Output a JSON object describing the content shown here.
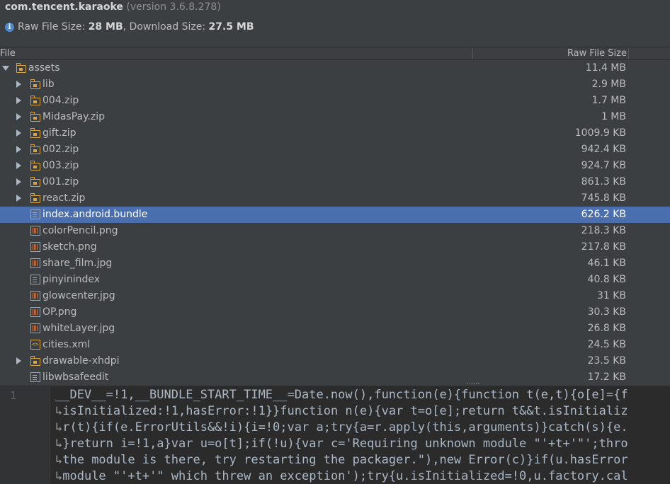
{
  "header": {
    "package_name": "com.tencent.karaoke",
    "version_text": " (version 3.6.8.278)",
    "raw_size_label": "Raw File Size: ",
    "raw_size_value": "28 MB",
    "download_size_label": ", Download Size: ",
    "download_size_value": "27.5 MB"
  },
  "columns": {
    "file": "File",
    "raw_size": "Raw File Size"
  },
  "tree": [
    {
      "name": "assets",
      "size": "11.4 MB",
      "type": "folder",
      "expanded": true,
      "depth": 0,
      "selected": false
    },
    {
      "name": "lib",
      "size": "2.9 MB",
      "type": "folder",
      "expanded": false,
      "depth": 1,
      "selected": false
    },
    {
      "name": "004.zip",
      "size": "1.7 MB",
      "type": "folder",
      "expanded": false,
      "depth": 1,
      "selected": false
    },
    {
      "name": "MidasPay.zip",
      "size": "1 MB",
      "type": "folder",
      "expanded": false,
      "depth": 1,
      "selected": false
    },
    {
      "name": "gift.zip",
      "size": "1009.9 KB",
      "type": "folder",
      "expanded": false,
      "depth": 1,
      "selected": false
    },
    {
      "name": "002.zip",
      "size": "942.4 KB",
      "type": "folder",
      "expanded": false,
      "depth": 1,
      "selected": false
    },
    {
      "name": "003.zip",
      "size": "924.7 KB",
      "type": "folder",
      "expanded": false,
      "depth": 1,
      "selected": false
    },
    {
      "name": "001.zip",
      "size": "861.3 KB",
      "type": "folder",
      "expanded": false,
      "depth": 1,
      "selected": false
    },
    {
      "name": "react.zip",
      "size": "745.8 KB",
      "type": "folder",
      "expanded": false,
      "depth": 1,
      "selected": false
    },
    {
      "name": "index.android.bundle",
      "size": "626.2 KB",
      "type": "file",
      "depth": 1,
      "selected": true
    },
    {
      "name": "colorPencil.png",
      "size": "218.3 KB",
      "type": "image",
      "depth": 1,
      "selected": false
    },
    {
      "name": "sketch.png",
      "size": "217.8 KB",
      "type": "image",
      "depth": 1,
      "selected": false
    },
    {
      "name": "share_film.jpg",
      "size": "46.1 KB",
      "type": "image",
      "depth": 1,
      "selected": false
    },
    {
      "name": "pinyinindex",
      "size": "40.8 KB",
      "type": "file",
      "depth": 1,
      "selected": false
    },
    {
      "name": "glowcenter.jpg",
      "size": "31 KB",
      "type": "image",
      "depth": 1,
      "selected": false
    },
    {
      "name": "OP.png",
      "size": "30.3 KB",
      "type": "image",
      "depth": 1,
      "selected": false
    },
    {
      "name": "whiteLayer.jpg",
      "size": "26.8 KB",
      "type": "image",
      "depth": 1,
      "selected": false
    },
    {
      "name": "cities.xml",
      "size": "24.5 KB",
      "type": "xml",
      "depth": 1,
      "selected": false
    },
    {
      "name": "drawable-xhdpi",
      "size": "23.5 KB",
      "type": "folder",
      "expanded": false,
      "depth": 1,
      "selected": false
    },
    {
      "name": "libwbsafeedit",
      "size": "17.2 KB",
      "type": "file",
      "depth": 1,
      "selected": false
    }
  ],
  "editor": {
    "line_number": "1",
    "lines": [
      "__DEV__=!1,__BUNDLE_START_TIME__=Date.now(),function(e){function t(e,t){o[e]={f",
      "isInitialized:!1,hasError:!1}}function n(e){var t=o[e];return t&&t.isInitializ",
      "r(t){if(e.ErrorUtils&&!i){i=!0;var a;try{a=r.apply(this,arguments)}catch(s){e.",
      "}return i=!1,a}var u=o[t];if(!u){var c='Requiring unknown module \"'+t+'\"';thro",
      "the module is there, try restarting the packager.\"),new Error(c)}if(u.hasError",
      "module \"'+t+'\" which threw an exception');try{u.isInitialized=!0,u.factory.cal"
    ],
    "wrap_marker": "↳"
  },
  "colors": {
    "selection": "#4b6eaf",
    "folder": "#d9a441",
    "background": "#3c3f41",
    "editor_bg": "#2b2b2b"
  }
}
